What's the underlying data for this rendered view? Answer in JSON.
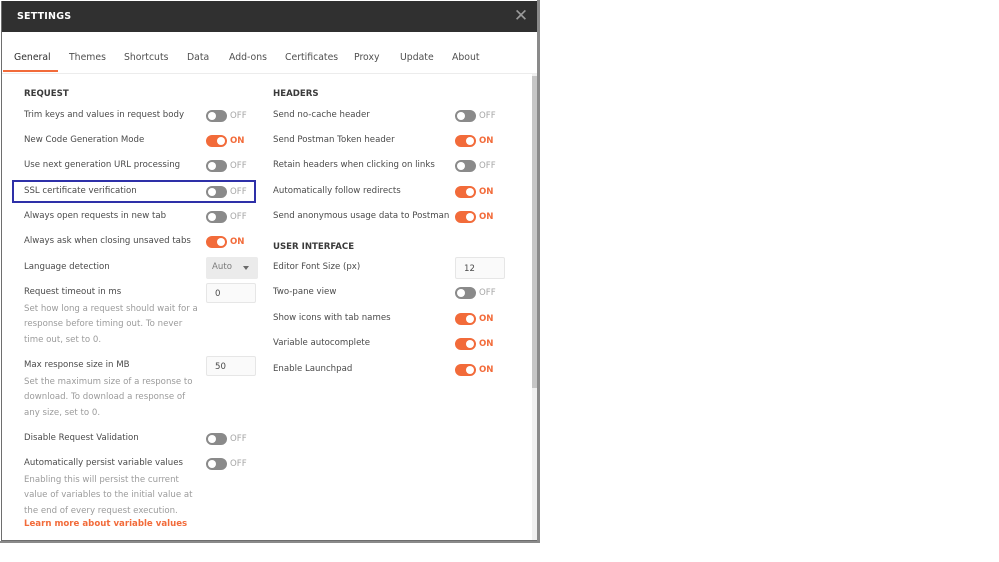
{
  "window": {
    "title": "SETTINGS",
    "close_icon": "close-icon"
  },
  "tabs": [
    {
      "label": "General",
      "active": true
    },
    {
      "label": "Themes",
      "active": false
    },
    {
      "label": "Shortcuts",
      "active": false
    },
    {
      "label": "Data",
      "active": false
    },
    {
      "label": "Add-ons",
      "active": false
    },
    {
      "label": "Certificates",
      "active": false
    },
    {
      "label": "Proxy",
      "active": false
    },
    {
      "label": "Update",
      "active": false
    },
    {
      "label": "About",
      "active": false
    }
  ],
  "accent_color": "#f26b3a",
  "highlight_color": "#2e30a8",
  "request": {
    "heading": "REQUEST",
    "trim_keys": {
      "label": "Trim keys and values in request body",
      "state": "OFF"
    },
    "code_generation": {
      "label": "New Code Generation Mode",
      "state": "ON"
    },
    "next_gen_url": {
      "label": "Use next generation URL processing",
      "state": "OFF"
    },
    "ssl_verification": {
      "label": "SSL certificate verification",
      "state": "OFF"
    },
    "open_new_tab": {
      "label": "Always open requests in new tab",
      "state": "OFF"
    },
    "ask_closing": {
      "label": "Always ask when closing unsaved tabs",
      "state": "ON"
    },
    "language_detection": {
      "label": "Language detection",
      "value": "Auto"
    },
    "request_timeout": {
      "label": "Request timeout in ms",
      "value": "0",
      "help": "Set how long a request should wait for a response before timing out. To never time out, set to 0."
    },
    "max_response_size": {
      "label": "Max response size in MB",
      "value": "50",
      "help": "Set the maximum size of a response to download. To download a response of any size, set to 0."
    },
    "disable_validation": {
      "label": "Disable Request Validation",
      "state": "OFF"
    },
    "persist_variables": {
      "label": "Automatically persist variable values",
      "state": "OFF",
      "help": "Enabling this will persist the current value of variables to the initial value at the end of every request execution.",
      "link": "Learn more about variable values"
    }
  },
  "headers": {
    "heading": "HEADERS",
    "no_cache": {
      "label": "Send no-cache header",
      "state": "OFF"
    },
    "postman_token": {
      "label": "Send Postman Token header",
      "state": "ON"
    },
    "retain_headers": {
      "label": "Retain headers when clicking on links",
      "state": "OFF"
    },
    "follow_redirects": {
      "label": "Automatically follow redirects",
      "state": "ON"
    },
    "usage_data": {
      "label": "Send anonymous usage data to Postman",
      "state": "ON"
    }
  },
  "user_interface": {
    "heading": "USER INTERFACE",
    "editor_font_size": {
      "label": "Editor Font Size (px)",
      "value": "12"
    },
    "two_pane": {
      "label": "Two-pane view",
      "state": "OFF"
    },
    "tab_icons": {
      "label": "Show icons with tab names",
      "state": "ON"
    },
    "variable_autocomplete": {
      "label": "Variable autocomplete",
      "state": "ON"
    },
    "launchpad": {
      "label": "Enable Launchpad",
      "state": "ON"
    }
  }
}
